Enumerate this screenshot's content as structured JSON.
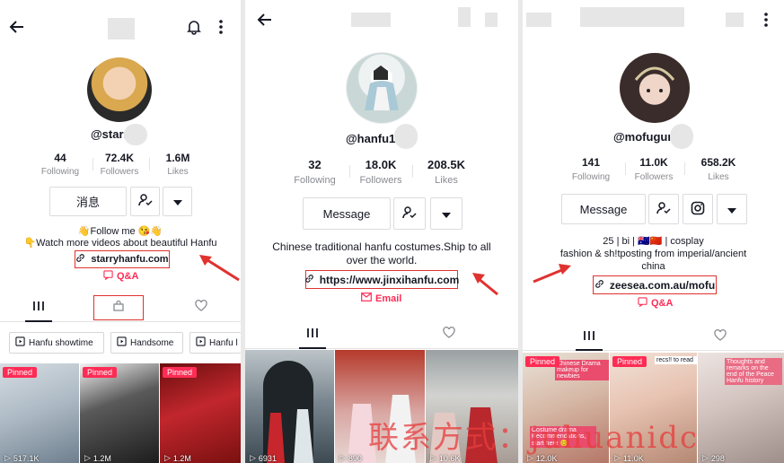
{
  "colors": {
    "accent": "#fe2c55",
    "highlight": "#e0322f",
    "text": "#161823",
    "muted": "#8a8b91"
  },
  "panel1": {
    "handle": "@starr",
    "stats": [
      {
        "value": "44",
        "label": "Following"
      },
      {
        "value": "72.4K",
        "label": "Followers"
      },
      {
        "value": "1.6M",
        "label": "Likes"
      }
    ],
    "message_button": "消息",
    "bio_line1": "👋Follow me 😘👋",
    "bio_line2": "👇Watch more videos about beautiful Hanfu",
    "link": "starryhanfu.com",
    "qa": "Q&A",
    "playlists": [
      "Hanfu showtime",
      "Handsome",
      "Hanfu l"
    ],
    "videos": [
      {
        "pinned": "Pinned",
        "views": "517.1K"
      },
      {
        "pinned": "Pinned",
        "views": "1.2M"
      },
      {
        "pinned": "Pinned",
        "views": "1.2M"
      }
    ]
  },
  "panel2": {
    "handle": "@hanfu1",
    "stats": [
      {
        "value": "32",
        "label": "Following"
      },
      {
        "value": "18.0K",
        "label": "Followers"
      },
      {
        "value": "208.5K",
        "label": "Likes"
      }
    ],
    "message_button": "Message",
    "bio": "Chinese traditional hanfu costumes.Ship to all over the world.",
    "link": "https://www.jinxihanfu.com",
    "email": "Email",
    "videos": [
      {
        "views": "6931"
      },
      {
        "views": "890"
      },
      {
        "views": "10.6K"
      }
    ]
  },
  "panel3": {
    "handle": "@mofugur",
    "stats": [
      {
        "value": "141",
        "label": "Following"
      },
      {
        "value": "11.0K",
        "label": "Followers"
      },
      {
        "value": "658.2K",
        "label": "Likes"
      }
    ],
    "message_button": "Message",
    "bio_line1": "25 | bi | 🇦🇺🇨🇳 | cosplay",
    "bio_line2": "fashion & sh!tposting from imperial/ancient",
    "bio_line3": "china",
    "link": "zeesea.com.au/mofu",
    "qa": "Q&A",
    "videos": [
      {
        "pinned": "Pinned",
        "views": "12.0K",
        "overlay_top": "Chinese Drama makeup for newbies",
        "overlay_bottom": "Costume drama Recommendations, start here 😊"
      },
      {
        "pinned": "Pinned",
        "views": "11.0K",
        "overlay_top": "recs!! to read",
        "overlay_bottom": ""
      },
      {
        "views": "298",
        "overlay_top": "Thoughts and remarks on the end of the Peace Hanfu history",
        "overlay_bottom": ""
      }
    ]
  },
  "watermark": "联系方式：juhuanidc",
  "icons": [
    "back-arrow-icon",
    "bell-icon",
    "more-vertical-icon",
    "follow-user-icon",
    "caret-down-icon",
    "instagram-icon",
    "link-icon",
    "qa-icon",
    "email-icon",
    "grid-icon",
    "shop-bag-icon",
    "liked-heart-icon",
    "playlist-icon",
    "play-icon"
  ]
}
